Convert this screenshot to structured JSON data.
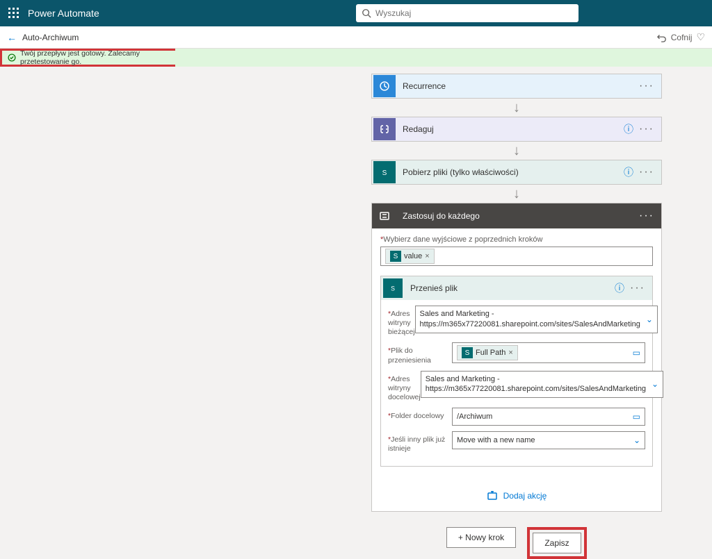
{
  "header": {
    "app": "Power Automate",
    "search_placeholder": "Wyszukaj"
  },
  "breadcrumb": {
    "flow_name": "Auto-Archiwum",
    "undo_label": "Cofnij"
  },
  "banner": {
    "message": "Twój przepływ jest gotowy. Zalecamy przetestowanie go."
  },
  "steps": {
    "recurrence": {
      "title": "Recurrence"
    },
    "compose": {
      "title": "Redaguj"
    },
    "getfiles": {
      "title": "Pobierz pliki (tylko właściwości)"
    }
  },
  "loop": {
    "title": "Zastosuj do każdego",
    "select_label": "Wybierz dane wyjściowe z poprzednich kroków",
    "token1": "value",
    "move": {
      "title": "Przenieś plik",
      "rows": {
        "site_current_label": "Adres witryny bieżącej",
        "site_current_value": "Sales and Marketing - https://m365x77220081.sharepoint.com/sites/SalesAndMarketing",
        "file_label": "Plik do przeniesienia",
        "file_token": "Full Path",
        "site_dest_label": "Adres witryny docelowej",
        "site_dest_value": "Sales and Marketing - https://m365x77220081.sharepoint.com/sites/SalesAndMarketing",
        "folder_label": "Folder docelowy",
        "folder_value": "/Archiwum",
        "overwrite_label": "Jeśli inny plik już istnieje",
        "overwrite_value": "Move with a new name"
      }
    },
    "add_action": "Dodaj akcję"
  },
  "buttons": {
    "new_step": "+ Nowy krok",
    "save": "Zapisz"
  }
}
